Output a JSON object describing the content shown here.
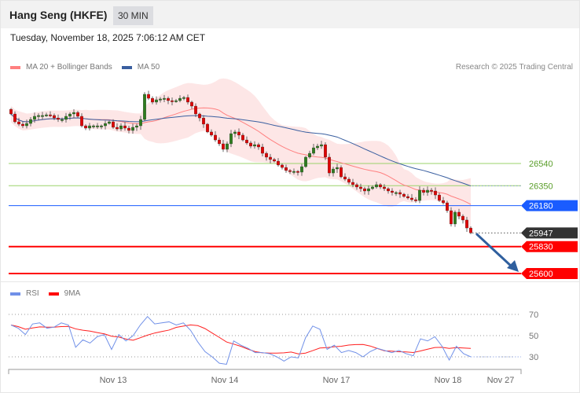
{
  "header": {
    "title": "Hang Seng (HKFE)",
    "interval": "30 MIN"
  },
  "timestamp": "Tuesday, November 18, 2025 7:06:12 AM CET",
  "legend": {
    "ma20": "MA 20 + Bollinger Bands",
    "ma50": "MA 50",
    "rsi": "RSI",
    "ma9": "9MA"
  },
  "credit": "Research © 2025 Trading Central",
  "colors": {
    "up": "#2e7d1e",
    "down": "#e00000",
    "ma20": "#ff8080",
    "ma50": "#3a5fa0",
    "band": "#fde2e2",
    "support": "#ff0000",
    "pivot": "#1a5cff",
    "resistance": "#9bd36a",
    "last": "#333333",
    "rsi": "#7090e8"
  },
  "chart_data": [
    {
      "type": "candlestick",
      "title": "Hang Seng (HKFE) 30 MIN",
      "closes": [
        26963,
        26896,
        26876,
        26862,
        26882,
        26916,
        26943,
        26950,
        26950,
        26956,
        26950,
        26929,
        26916,
        26916,
        26943,
        26963,
        26976,
        26943,
        26862,
        26842,
        26862,
        26862,
        26862,
        26862,
        26882,
        26896,
        26849,
        26835,
        26862,
        26842,
        26822,
        26849,
        26862,
        26916,
        27131,
        27097,
        27064,
        27084,
        27091,
        27097,
        27077,
        27070,
        27077,
        27097,
        27104,
        27064,
        27030,
        26963,
        26929,
        26876,
        26809,
        26782,
        26741,
        26708,
        26661,
        26708,
        26795,
        26809,
        26782,
        26741,
        26715,
        26688,
        26701,
        26681,
        26627,
        26594,
        26574,
        26560,
        26527,
        26506,
        26480,
        26473,
        26473,
        26466,
        26513,
        26594,
        26627,
        26674,
        26688,
        26701,
        26594,
        26459,
        26493,
        26506,
        26426,
        26406,
        26379,
        26359,
        26339,
        26325,
        26305,
        26325,
        26339,
        26359,
        26339,
        26325,
        26305,
        26292,
        26292,
        26278,
        26258,
        26245,
        26231,
        26224,
        26312,
        26292,
        26312,
        26305,
        26271,
        26224,
        26204,
        26137,
        26023,
        26124,
        26090,
        26057,
        25989,
        25947
      ],
      "levels": [
        {
          "label": "26540",
          "value": 26540,
          "kind": "resistance"
        },
        {
          "label": "26350",
          "value": 26350,
          "kind": "resistance"
        },
        {
          "label": "26180",
          "value": 26180,
          "kind": "pivot"
        },
        {
          "label": "25947",
          "value": 25947,
          "kind": "last"
        },
        {
          "label": "25830",
          "value": 25830,
          "kind": "support"
        },
        {
          "label": "25600",
          "value": 25600,
          "kind": "support"
        }
      ],
      "forecast_arrow": {
        "from": 25947,
        "to": 25600,
        "direction": "down"
      },
      "x_ticks": [
        "Nov 13",
        "Nov 14",
        "Nov 17",
        "Nov 18",
        "Nov 27"
      ]
    },
    {
      "type": "line",
      "title": "RSI",
      "series": [
        {
          "name": "RSI",
          "values": [
            60,
            57,
            51,
            61,
            62,
            57,
            58,
            62,
            60,
            39,
            46,
            43,
            49,
            51,
            37,
            51,
            45,
            50,
            60,
            68,
            61,
            62,
            63,
            60,
            62,
            55,
            44,
            35,
            30,
            24,
            23,
            45,
            41,
            38,
            34,
            34,
            33,
            30,
            26,
            30,
            29,
            48,
            59,
            56,
            37,
            41,
            34,
            36,
            34,
            30,
            35,
            38,
            36,
            34,
            36,
            33,
            31,
            47,
            45,
            49,
            40,
            27,
            40,
            33,
            30
          ]
        }
      ],
      "y_ticks": [
        70,
        50,
        30
      ],
      "ylim": [
        20,
        75
      ]
    }
  ]
}
